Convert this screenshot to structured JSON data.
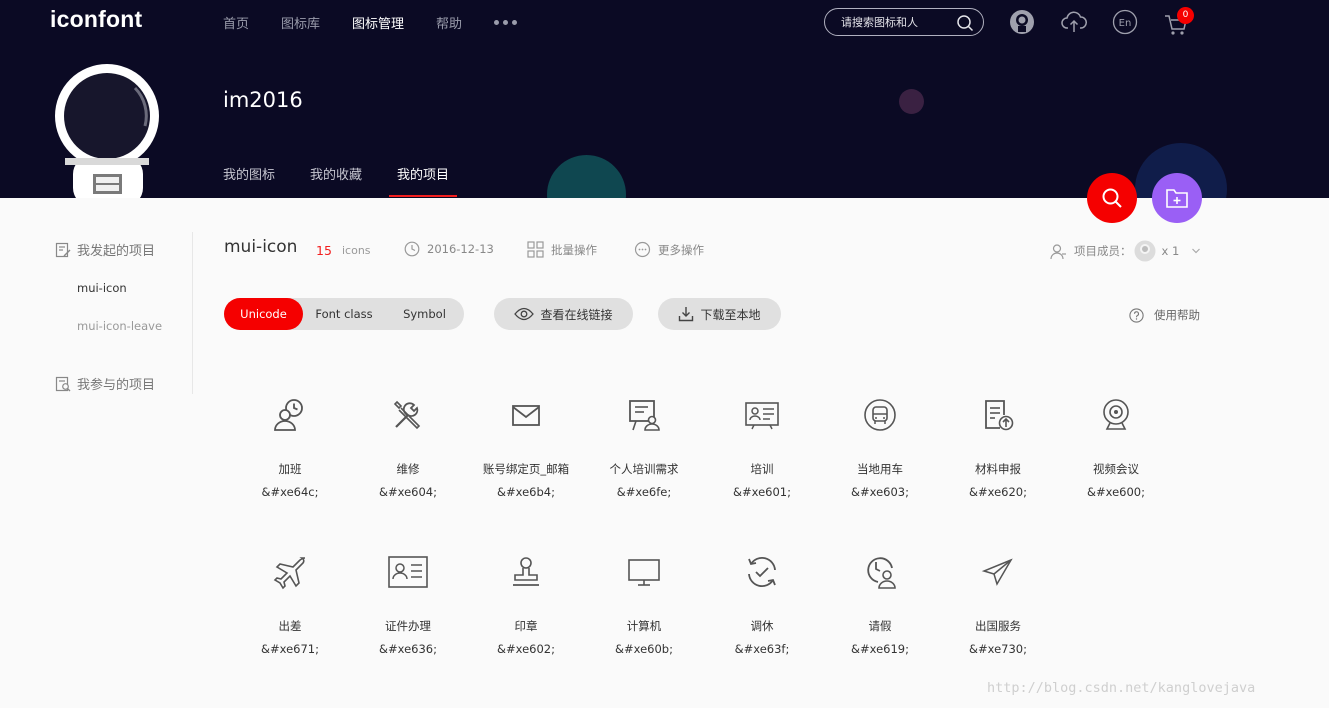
{
  "header": {
    "logo": "iconfont",
    "nav": [
      "首页",
      "图标库",
      "图标管理",
      "帮助"
    ],
    "nav_active": 2,
    "search_placeholder": "请搜索图标和人",
    "cart_count": "0",
    "lang_label": "En"
  },
  "profile": {
    "username": "im2016",
    "tabs": [
      "我的图标",
      "我的收藏",
      "我的项目"
    ]
  },
  "sidebar": {
    "created_heading": "我发起的项目",
    "created_items": [
      "mui-icon",
      "mui-icon-leave"
    ],
    "joined_heading": "我参与的项目"
  },
  "project": {
    "name": "mui-icon",
    "count": "15",
    "count_unit": "icons",
    "date": "2016-12-13",
    "batch_label": "批量操作",
    "more_label": "更多操作",
    "members_label": "项目成员：",
    "members_count": "x 1"
  },
  "toolbar": {
    "formats": [
      "Unicode",
      "Font class",
      "Symbol"
    ],
    "format_active": 0,
    "view_link": "查看在线链接",
    "download": "下载至本地",
    "help": "使用帮助"
  },
  "icons": [
    {
      "name": "加班",
      "code": "&#xe64c;",
      "glyph": "clock-user"
    },
    {
      "name": "维修",
      "code": "&#xe604;",
      "glyph": "tools"
    },
    {
      "name": "账号绑定页_邮箱",
      "code": "&#xe6b4;",
      "glyph": "mail"
    },
    {
      "name": "个人培训需求",
      "code": "&#xe6fe;",
      "glyph": "board-user"
    },
    {
      "name": "培训",
      "code": "&#xe601;",
      "glyph": "id-board"
    },
    {
      "name": "当地用车",
      "code": "&#xe603;",
      "glyph": "bus"
    },
    {
      "name": "材料申报",
      "code": "&#xe620;",
      "glyph": "doc-upload"
    },
    {
      "name": "视频会议",
      "code": "&#xe600;",
      "glyph": "webcam"
    },
    {
      "name": "出差",
      "code": "&#xe671;",
      "glyph": "plane"
    },
    {
      "name": "证件办理",
      "code": "&#xe636;",
      "glyph": "id-card"
    },
    {
      "name": "印章",
      "code": "&#xe602;",
      "glyph": "stamp"
    },
    {
      "name": "计算机",
      "code": "&#xe60b;",
      "glyph": "monitor"
    },
    {
      "name": "调休",
      "code": "&#xe63f;",
      "glyph": "cycle-check"
    },
    {
      "name": "请假",
      "code": "&#xe619;",
      "glyph": "clock-person"
    },
    {
      "name": "出国服务",
      "code": "&#xe730;",
      "glyph": "paper-plane"
    }
  ],
  "watermark": "http://blog.csdn.net/kanglovejava"
}
